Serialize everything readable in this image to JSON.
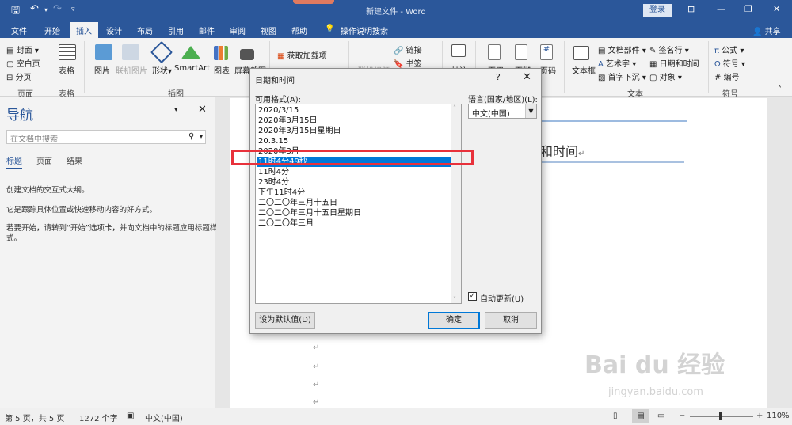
{
  "title_bar": {
    "doc_title": "新建文件 - Word",
    "login": "登录",
    "share": "共享"
  },
  "menu": {
    "tabs": [
      "文件",
      "开始",
      "插入",
      "设计",
      "布局",
      "引用",
      "邮件",
      "审阅",
      "视图",
      "帮助"
    ],
    "active_tab": "插入",
    "tell_me": "操作说明搜索"
  },
  "ribbon": {
    "pages_group": {
      "items": [
        "封面",
        "空白页",
        "分页"
      ],
      "name": "页面"
    },
    "tables_group": {
      "item": "表格",
      "name": "表格"
    },
    "illus_group": {
      "items": [
        "图片",
        "联机图片",
        "形状",
        "SmartArt",
        "图表",
        "屏幕截图"
      ],
      "name": "插图"
    },
    "addins": {
      "item": "获取加载项"
    },
    "media": {
      "item": "联机视频"
    },
    "links": {
      "items": [
        "链接",
        "书签"
      ]
    },
    "comment": {
      "item": "批注"
    },
    "header_footer": {
      "items": [
        "页眉",
        "页脚",
        "页码"
      ]
    },
    "text_group": {
      "items": [
        "文本框",
        "文档部件",
        "艺术字",
        "首字下沉",
        "签名行",
        "日期和时间",
        "对象"
      ],
      "name": "文本"
    },
    "symbols_group": {
      "items": [
        "公式",
        "符号",
        "编号"
      ],
      "name": "符号"
    }
  },
  "nav_pane": {
    "title": "导航",
    "search_placeholder": "在文档中搜索",
    "tabs": [
      "标题",
      "页面",
      "结果"
    ],
    "messages": [
      "创建文档的交互式大纲。",
      "它是跟踪具体位置或快速移动内容的好方式。",
      "若要开始，请转到“开始”选项卡，并向文档中的标题应用标题样式。"
    ]
  },
  "document": {
    "heading_fragment": "和时间"
  },
  "dialog": {
    "title": "日期和时间",
    "help": "?",
    "close": "✕",
    "formats_label": "可用格式(A):",
    "language_label": "语言(国家/地区)(L):",
    "language_value": "中文(中国)",
    "formats": [
      "2020/3/15",
      "2020年3月15日",
      "2020年3月15日星期日",
      "20.3.15",
      "2020年3月",
      "11时4分49秒",
      "11时4分",
      "23时4分",
      "下午11时4分",
      "二〇二〇年三月十五日",
      "二〇二〇年三月十五日星期日",
      "二〇二〇年三月"
    ],
    "selected_index": 5,
    "auto_update_label": "自动更新(U)",
    "auto_update_checked": true,
    "set_default": "设为默认值(D)",
    "ok": "确定",
    "cancel": "取消"
  },
  "status_bar": {
    "page": "第 5 页，共 5 页",
    "words": "1272 个字",
    "language": "中文(中国)",
    "zoom": "110%"
  },
  "watermark": {
    "brand": "Bai du 经验",
    "url": "jingyan.baidu.com"
  },
  "colors": {
    "accent": "#2b579a",
    "selection": "#0078d7",
    "highlight_box": "#e8313b"
  }
}
